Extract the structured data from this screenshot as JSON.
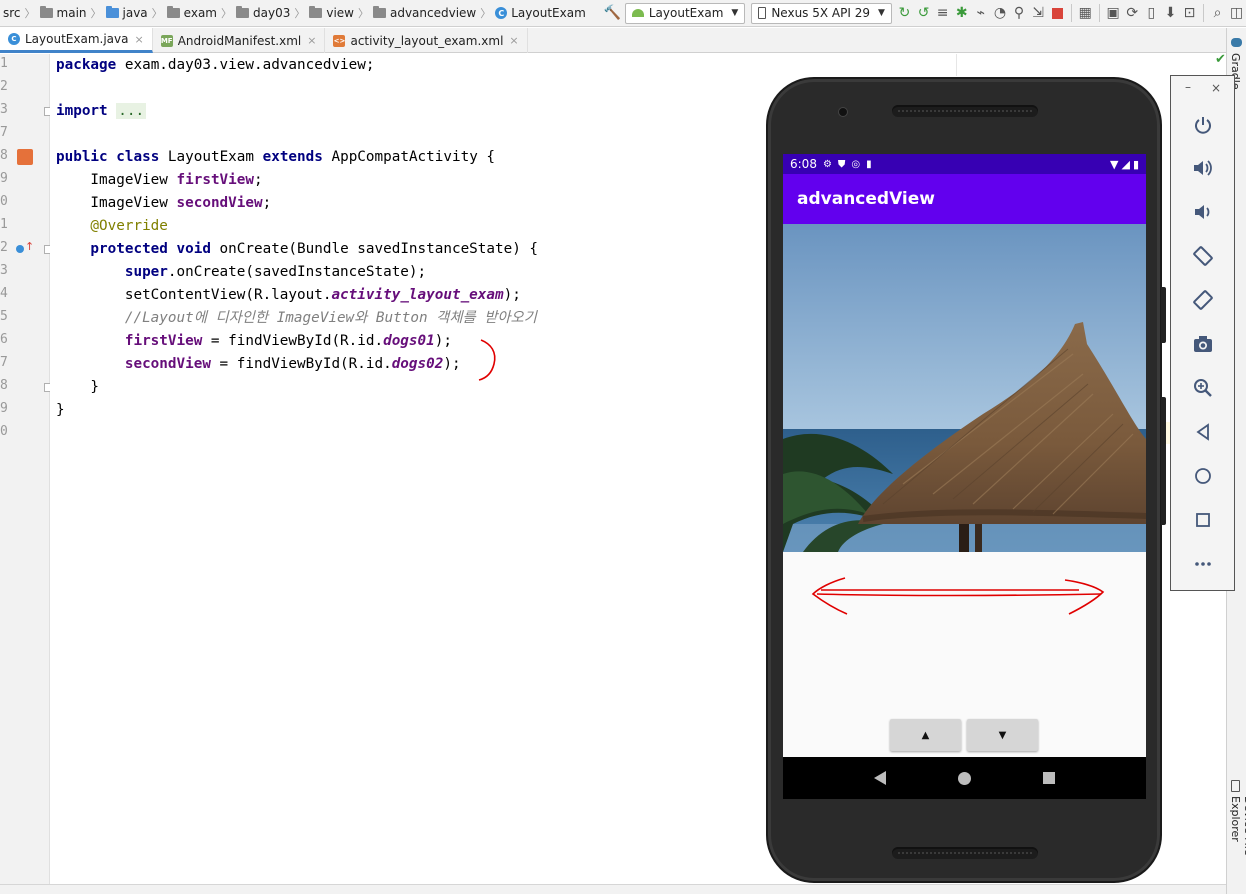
{
  "breadcrumbs": [
    "src",
    "main",
    "java",
    "exam",
    "day03",
    "view",
    "advancedview",
    "LayoutExam"
  ],
  "toolbar": {
    "run_config": "LayoutExam",
    "device": "Nexus 5X API 29"
  },
  "tabs": [
    {
      "label": "LayoutExam.java",
      "active": true
    },
    {
      "label": "AndroidManifest.xml",
      "active": false
    },
    {
      "label": "activity_layout_exam.xml",
      "active": false
    }
  ],
  "gutter_numbers": [
    "1",
    "2",
    "3",
    "7",
    "8",
    "9",
    "0",
    "1",
    "2",
    "3",
    "4",
    "5",
    "6",
    "7",
    "8",
    "9",
    "0"
  ],
  "code": {
    "l1": {
      "kw": "package",
      "rest": " exam.day03.view.advancedview;"
    },
    "l3": {
      "kw": "import",
      "fold": "..."
    },
    "l8": {
      "kw1": "public",
      "kw2": "class",
      "name": " LayoutExam ",
      "kw3": "extends",
      "rest": " AppCompatActivity {"
    },
    "l9": {
      "type": "    ImageView ",
      "field": "firstView",
      "end": ";"
    },
    "l10": {
      "type": "    ImageView ",
      "field": "secondView",
      "end": ";"
    },
    "l11": {
      "ann": "    @Override"
    },
    "l12": {
      "kw1": "    protected",
      "kw2": "void",
      "rest": " onCreate(Bundle savedInstanceState) {"
    },
    "l13": {
      "kw": "        super",
      "rest": ".onCreate(savedInstanceState);"
    },
    "l14": {
      "pre": "        setContentView(R.layout.",
      "field": "activity_layout_exam",
      "end": ");"
    },
    "l15": {
      "comment": "        //Layout에 디자인한 ImageView와 Button 객체를 받아오기"
    },
    "l16": {
      "field": "        firstView",
      "mid": " = findViewById(R.id.",
      "field2": "dogs01",
      "end": ");"
    },
    "l17": {
      "field": "        secondView",
      "mid": " = findViewById(R.id.",
      "field2": "dogs02",
      "end": ");"
    },
    "l18": {
      "text": "    }"
    },
    "l19": {
      "text": "}"
    }
  },
  "device": {
    "time": "6:08",
    "app_title": "advancedView",
    "button_up": "▲",
    "button_down": "▼"
  },
  "right_strip": {
    "gradle": "Gradle",
    "device_file_explorer": "Device File Explorer"
  },
  "emulator_controls": [
    "power-icon",
    "volume-up-icon",
    "volume-down-icon",
    "rotate-left-icon",
    "rotate-right-icon",
    "camera-icon",
    "zoom-icon",
    "back-icon",
    "home-icon",
    "overview-icon",
    "more-icon"
  ],
  "colors": {
    "app_bar": "#6200ee",
    "status_bar": "#3700b3",
    "annotation_red": "#e00000"
  }
}
